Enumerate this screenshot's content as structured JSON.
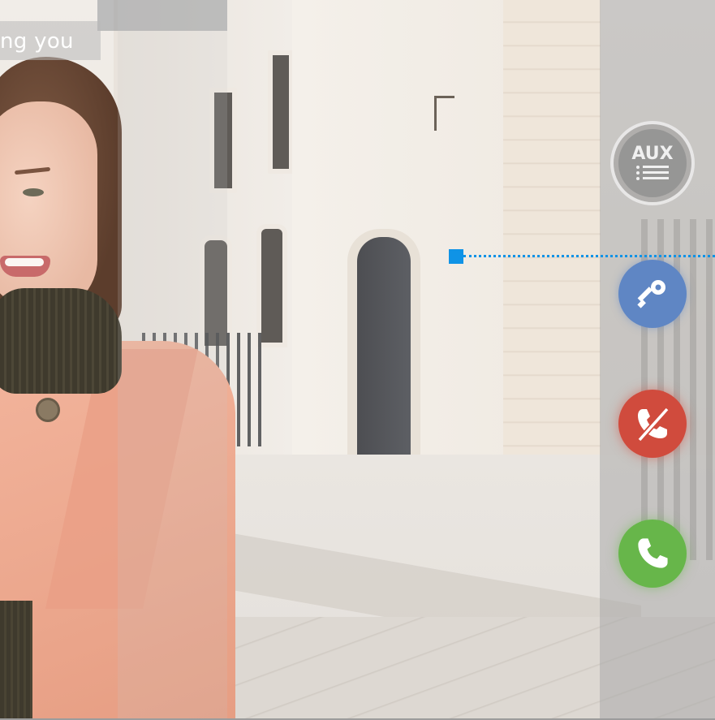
{
  "banner": {
    "text": "ng you"
  },
  "controls": {
    "aux": {
      "label": "AUX",
      "icon": "aux-list-icon"
    },
    "door_open": {
      "icon": "key-icon",
      "color": "#5f86c4"
    },
    "reject_call": {
      "icon": "phone-hangup-icon",
      "color": "#d04b3d"
    },
    "accept_call": {
      "icon": "phone-icon",
      "color": "#67b64a"
    }
  },
  "annotation": {
    "color": "#0f93e6"
  }
}
